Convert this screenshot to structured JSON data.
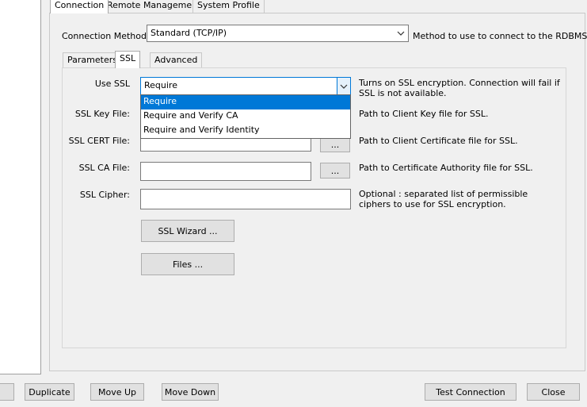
{
  "top_tabs": [
    "Connection",
    "Remote Management",
    "System Profile"
  ],
  "connection_method": {
    "label": "Connection Method:",
    "value": "Standard (TCP/IP)",
    "help": "Method to use to connect to the RDBMS"
  },
  "sub_tabs": [
    "Parameters",
    "SSL",
    "Advanced"
  ],
  "ssl": {
    "use_ssl": {
      "label": "Use SSL",
      "value": "Require",
      "help": "Turns on SSL encryption. Connection will fail if SSL is not available.",
      "options": [
        "Require",
        "Require and Verify CA",
        "Require and Verify Identity"
      ]
    },
    "key_file": {
      "label": "SSL Key File:",
      "value": "",
      "help": "Path to Client Key file for SSL."
    },
    "cert_file": {
      "label": "SSL CERT File:",
      "value": "",
      "browse": "...",
      "help": "Path to Client Certificate file for SSL."
    },
    "ca_file": {
      "label": "SSL CA File:",
      "value": "",
      "browse": "...",
      "help": "Path to Certificate Authority file for SSL."
    },
    "cipher": {
      "label": "SSL Cipher:",
      "value": "",
      "help": "Optional : separated list of permissible ciphers to use for SSL encryption."
    },
    "wizard_button": "SSL Wizard ...",
    "files_button": "Files ..."
  },
  "bottom_buttons": {
    "duplicate": "Duplicate",
    "move_up": "Move Up",
    "move_down": "Move Down",
    "test_connection": "Test Connection",
    "close": "Close"
  },
  "icons": {
    "combo_arrow": "chevron-down-icon"
  },
  "colors": {
    "accent": "#0078d7",
    "window_bg": "#f0f0f0"
  }
}
